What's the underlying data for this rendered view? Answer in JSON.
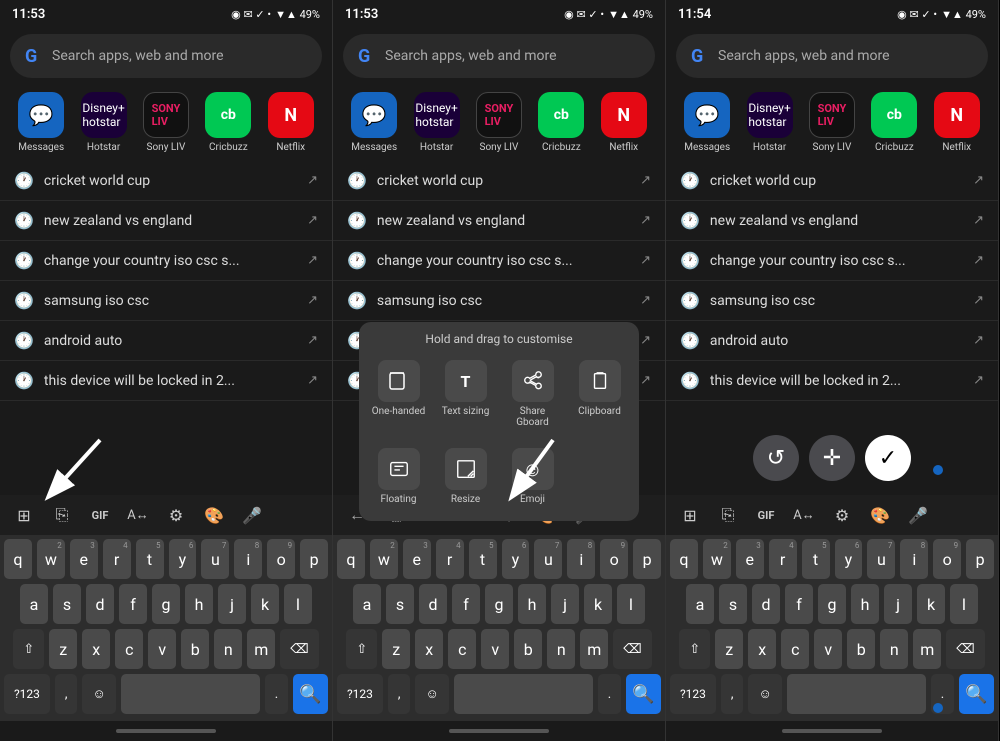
{
  "panels": [
    {
      "id": "panel1",
      "status": {
        "time": "11:53",
        "icons": "▲ ◉ ✓ • ▼ ▲ 49%"
      },
      "search": {
        "placeholder": "Search apps, web and more"
      },
      "apps": [
        {
          "label": "Messages",
          "color": "#1565C0",
          "icon": "💬"
        },
        {
          "label": "Hotstar",
          "color": "#1a0038",
          "icon": "▶"
        },
        {
          "label": "Sony LIV",
          "color": "#111",
          "icon": "▶"
        },
        {
          "label": "Cricbuzz",
          "color": "#00c853",
          "icon": "🏏"
        },
        {
          "label": "Netflix",
          "color": "#e50914",
          "icon": "N"
        }
      ],
      "suggestions": [
        {
          "text": "cricket world cup",
          "has_arrow": true
        },
        {
          "text": "new zealand vs england",
          "has_arrow": true
        },
        {
          "text": "change your country iso csc s...",
          "has_arrow": true
        },
        {
          "text": "samsung iso csc",
          "has_arrow": true
        },
        {
          "text": "android auto",
          "has_arrow": true
        },
        {
          "text": "this device will be locked in 2...",
          "has_arrow": true
        }
      ],
      "keyboard": {
        "row1": [
          "q",
          "w",
          "e",
          "r",
          "t",
          "y",
          "u",
          "i",
          "o",
          "p"
        ],
        "row1_nums": [
          "",
          "2",
          "3",
          "4",
          "5",
          "6",
          "7",
          "8",
          "9",
          ""
        ],
        "row2": [
          "a",
          "s",
          "d",
          "f",
          "g",
          "h",
          "j",
          "k",
          "l"
        ],
        "row3": [
          "z",
          "x",
          "c",
          "v",
          "b",
          "n",
          "m"
        ],
        "special_left": "⇧",
        "special_right": "⌫",
        "bottom_left": "?123",
        "bottom_comma": ",",
        "bottom_emoji": "☺",
        "bottom_space": "",
        "bottom_period": ".",
        "bottom_search": "🔍"
      }
    },
    {
      "id": "panel2",
      "status": {
        "time": "11:53",
        "icons": "▲ ◉ ✓ • ▼ ▲ 49%"
      },
      "search": {
        "placeholder": "Search apps, web and more"
      },
      "apps": [
        {
          "label": "Messages",
          "color": "#1565C0",
          "icon": "💬"
        },
        {
          "label": "Hotstar",
          "color": "#1a0038",
          "icon": "▶"
        },
        {
          "label": "Sony LIV",
          "color": "#111",
          "icon": "▶"
        },
        {
          "label": "Cricbuzz",
          "color": "#00c853",
          "icon": "🏏"
        },
        {
          "label": "Netflix",
          "color": "#e50914",
          "icon": "N"
        }
      ],
      "suggestions": [
        {
          "text": "cricket world cup",
          "has_arrow": true
        },
        {
          "text": "new zealand vs england",
          "has_arrow": true
        },
        {
          "text": "change your country iso csc s...",
          "has_arrow": true
        },
        {
          "text": "samsung iso csc",
          "has_arrow": true
        },
        {
          "text": "android auto",
          "has_arrow": true
        },
        {
          "text": "this device will be locked in 2...",
          "has_arrow": true
        }
      ],
      "context_menu": {
        "hint": "Hold and drag to customise",
        "items": [
          {
            "label": "One-handed",
            "icon": "☰"
          },
          {
            "label": "Text sizing",
            "icon": "T"
          },
          {
            "label": "Share Gboard",
            "icon": "↗"
          },
          {
            "label": "Clipboard",
            "icon": "📋"
          },
          {
            "label": "Floating",
            "icon": "⊞"
          },
          {
            "label": "Resize",
            "icon": "⊡"
          },
          {
            "label": "Emoji",
            "icon": "☺"
          }
        ]
      }
    },
    {
      "id": "panel3",
      "status": {
        "time": "11:54",
        "icons": "▲ ◉ ✓ • ▼ ▲ 49%"
      },
      "search": {
        "placeholder": "Search apps, web and more"
      },
      "apps": [
        {
          "label": "Messages",
          "color": "#1565C0",
          "icon": "💬"
        },
        {
          "label": "Hotstar",
          "color": "#1a0038",
          "icon": "▶"
        },
        {
          "label": "Sony LIV",
          "color": "#111",
          "icon": "▶"
        },
        {
          "label": "Cricbuzz",
          "color": "#00c853",
          "icon": "🏏"
        },
        {
          "label": "Netflix",
          "color": "#e50914",
          "icon": "N"
        }
      ],
      "suggestions": [
        {
          "text": "cricket world cup",
          "has_arrow": true
        },
        {
          "text": "new zealand vs england",
          "has_arrow": true
        },
        {
          "text": "change your country iso csc s...",
          "has_arrow": true
        },
        {
          "text": "samsung iso csc",
          "has_arrow": true
        },
        {
          "text": "android auto",
          "has_arrow": true
        },
        {
          "text": "this device will be locked in 2...",
          "has_arrow": true
        }
      ]
    }
  ],
  "toolbar_icons": {
    "grid": "⊞",
    "clipboard_tool": "⎘",
    "gif": "GIF",
    "translate": "A",
    "settings": "⚙",
    "palette": "🎨",
    "mic": "🎤",
    "back": "←"
  },
  "labels": {
    "one_handed": "One-handed",
    "text_sizing": "Text sizing",
    "share_gboard": "Share Gboard",
    "clipboard": "Clipboard",
    "floating": "Floating",
    "resize": "Resize",
    "emoji": "Emoji",
    "hold_hint": "Hold and drag to customise"
  }
}
